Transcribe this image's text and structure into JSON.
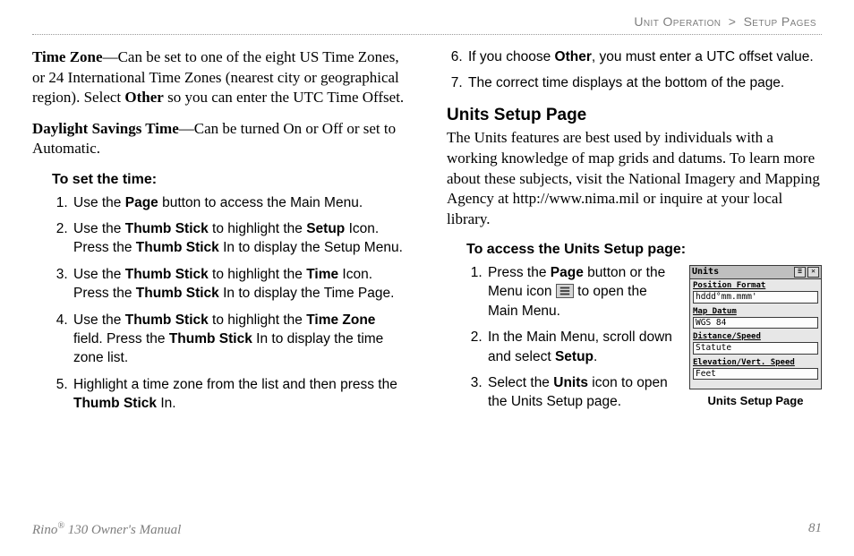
{
  "running_head": {
    "section": "Unit Operation",
    "sep": ">",
    "subsection": "Setup Pages"
  },
  "left": {
    "tz_lead": "Time Zone",
    "tz_body": "—Can be set to one of the eight US Time Zones, or 24 International Time Zones (nearest city or geographical region). Select ",
    "tz_other": "Other",
    "tz_tail": " so you can enter the UTC Time Offset.",
    "dst_lead": "Daylight Savings Time",
    "dst_body": "—Can be turned On or Off or set to Automatic.",
    "proc_head": "To set the time:",
    "steps": {
      "s1a": "Use the ",
      "s1b": "Page",
      "s1c": " button to access the Main Menu.",
      "s2a": "Use the ",
      "s2b": "Thumb Stick",
      "s2c": " to highlight the ",
      "s2d": "Setup",
      "s2e": " Icon. Press the ",
      "s2f": "Thumb Stick",
      "s2g": " In to display the Setup Menu.",
      "s3a": "Use the ",
      "s3b": "Thumb Stick",
      "s3c": " to highlight the ",
      "s3d": "Time",
      "s3e": " Icon. Press the ",
      "s3f": "Thumb Stick",
      "s3g": " In to display the Time Page.",
      "s4a": "Use the ",
      "s4b": "Thumb Stick",
      "s4c": " to highlight the ",
      "s4d": "Time Zone",
      "s4e": " field. Press the ",
      "s4f": "Thumb Stick",
      "s4g": " In to display the time zone list.",
      "s5a": "Highlight a time zone from the list and then press the ",
      "s5b": "Thumb Stick",
      "s5c": " In."
    }
  },
  "right": {
    "s6a": "If you choose ",
    "s6b": "Other",
    "s6c": ", you must enter a UTC offset value.",
    "s7": "The correct time displays at the bottom of the page.",
    "h2": "Units Setup Page",
    "intro": "The Units features are best used by individuals with a working knowledge of map grids and datums. To learn more about these subjects, visit the National Imagery and Mapping Agency at http://www.nima.mil or inquire at your local library.",
    "proc_head": "To access the Units Setup page:",
    "a1a": "Press the ",
    "a1b": "Page",
    "a1c": " button or the Menu icon ",
    "a1d": " to open the Main Menu.",
    "a2a": "In the Main Menu, scroll down and select ",
    "a2b": "Setup",
    "a2c": ".",
    "a3a": "Select the ",
    "a3b": "Units",
    "a3c": " icon to open the Units Setup page.",
    "figure": {
      "title": "Units",
      "rows": {
        "l1": "Position Format",
        "v1": "hddd°mm.mmm'",
        "l2": "Map Datum",
        "v2": "WGS 84",
        "l3": "Distance/Speed",
        "v3": "Statute",
        "l4": "Elevation/Vert. Speed",
        "v4": "Feet"
      },
      "caption": "Units Setup Page"
    }
  },
  "footer": {
    "product_a": "Rino",
    "product_reg": "®",
    "product_b": " 130 Owner's Manual",
    "page": "81"
  }
}
